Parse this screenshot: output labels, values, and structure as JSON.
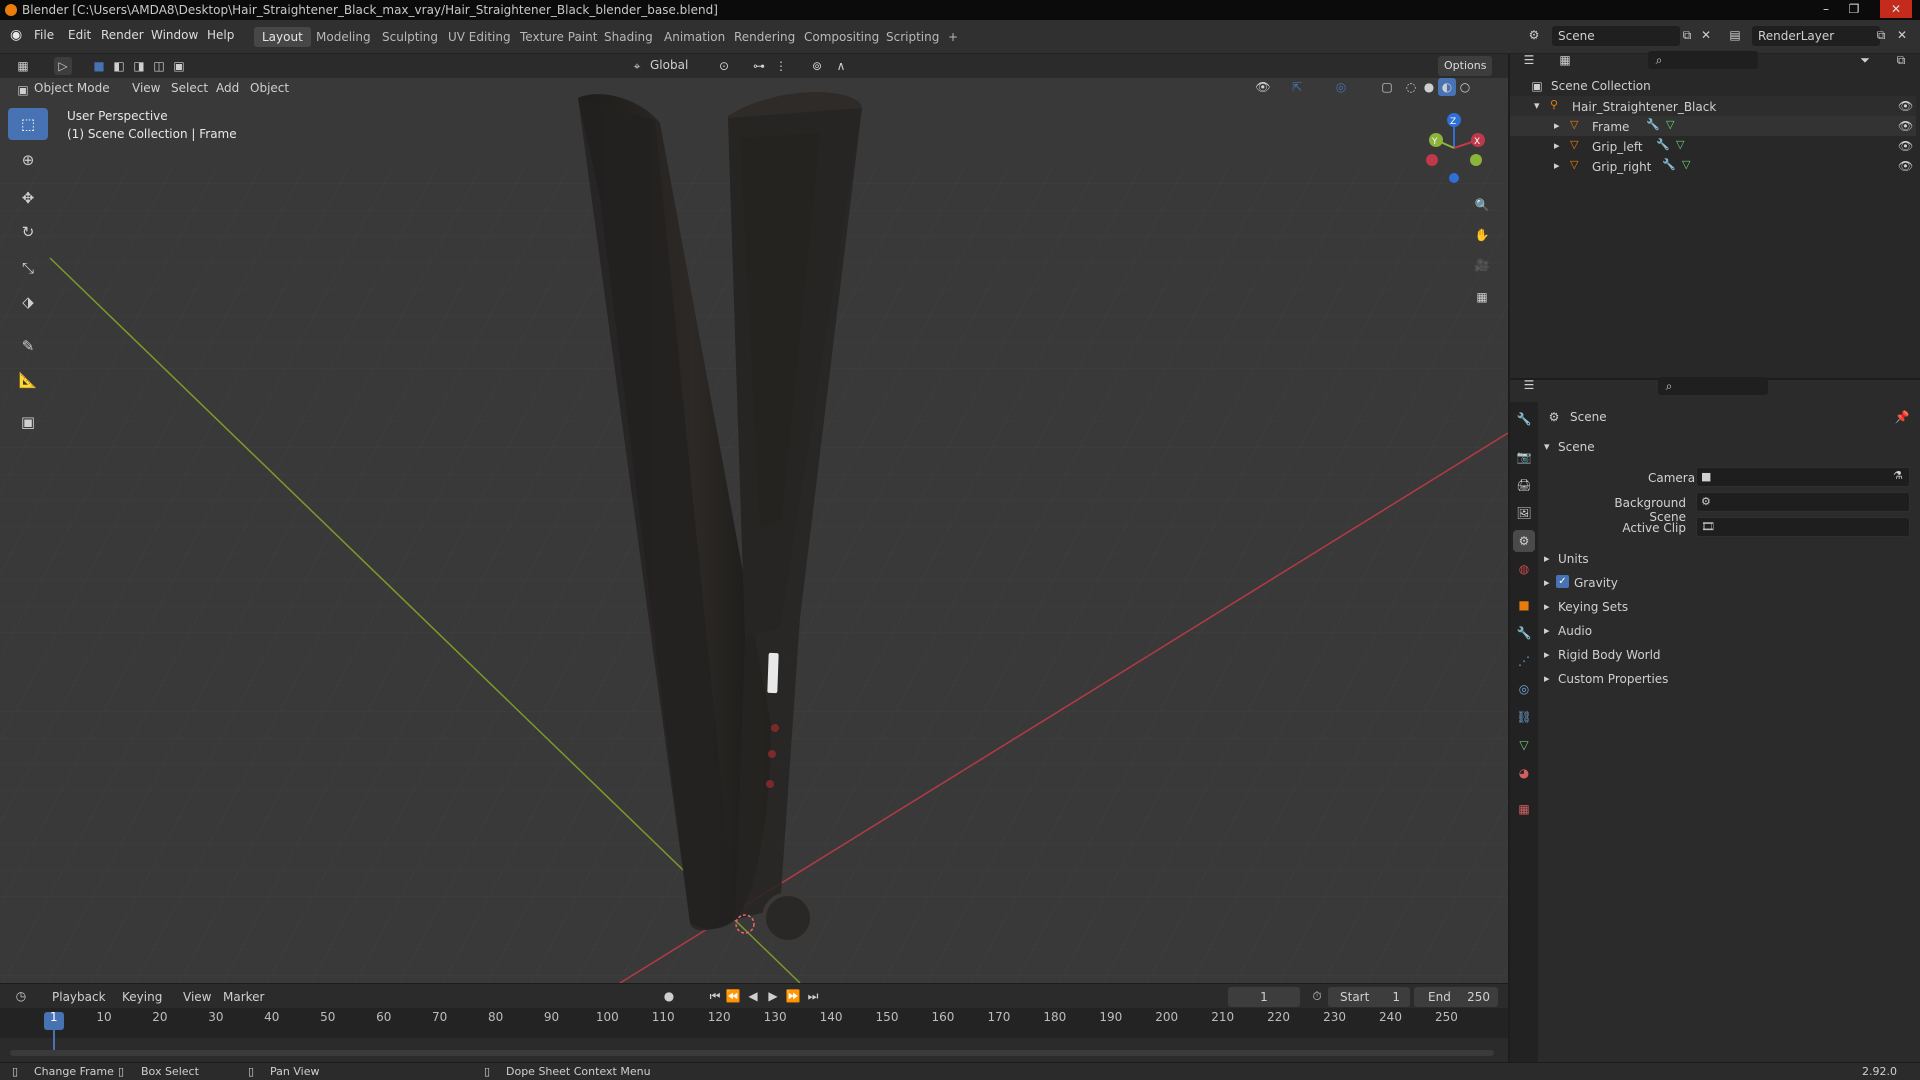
{
  "window": {
    "title": "Blender [C:\\Users\\AMDA8\\Desktop\\Hair_Straightener_Black_max_vray/Hair_Straightener_Black_blender_base.blend]"
  },
  "menu": [
    "File",
    "Edit",
    "Render",
    "Window",
    "Help"
  ],
  "workspaces": [
    "Layout",
    "Modeling",
    "Sculpting",
    "UV Editing",
    "Texture Paint",
    "Shading",
    "Animation",
    "Rendering",
    "Compositing",
    "Scripting"
  ],
  "active_workspace": "Layout",
  "scene_selector": "Scene",
  "render_layer": "RenderLayer",
  "header": {
    "transform_orientation": "Global",
    "options": "Options"
  },
  "viewport_header": {
    "mode": "Object Mode",
    "menus": [
      "View",
      "Select",
      "Add",
      "Object"
    ]
  },
  "viewport": {
    "perspective": "User Perspective",
    "context": "(1) Scene Collection | Frame"
  },
  "gizmo": {
    "x": "X",
    "y": "Y",
    "z": "Z"
  },
  "outliner": {
    "root": "Scene Collection",
    "collection": "Hair_Straightener_Black",
    "objects": [
      "Frame",
      "Grip_left",
      "Grip_right"
    ]
  },
  "properties": {
    "context": "Scene",
    "section": "Scene",
    "fields": [
      {
        "label": "Camera",
        "value": ""
      },
      {
        "label": "Background Scene",
        "value": ""
      },
      {
        "label": "Active Clip",
        "value": ""
      }
    ],
    "panels": [
      "Units",
      "Gravity",
      "Keying Sets",
      "Audio",
      "Rigid Body World",
      "Custom Properties"
    ],
    "gravity_checked": true
  },
  "timeline": {
    "menus": [
      "Playback",
      "Keying",
      "View",
      "Marker"
    ],
    "current_frame": "1",
    "start_label": "Start",
    "start": "1",
    "end_label": "End",
    "end": "250",
    "ruler": [
      "1",
      "10",
      "20",
      "30",
      "40",
      "50",
      "60",
      "70",
      "80",
      "90",
      "100",
      "110",
      "120",
      "130",
      "140",
      "150",
      "160",
      "170",
      "180",
      "190",
      "200",
      "210",
      "220",
      "230",
      "240",
      "250"
    ]
  },
  "statusbar": {
    "items": [
      "Change Frame",
      "Box Select",
      "Pan View",
      "Dope Sheet Context Menu"
    ],
    "version": "2.92.0"
  },
  "colors": {
    "accent": "#4772b3",
    "x_axis": "#c0394a",
    "y_axis": "#8cb33a",
    "z_axis": "#2f6fd6",
    "orange": "#e87d0d"
  }
}
